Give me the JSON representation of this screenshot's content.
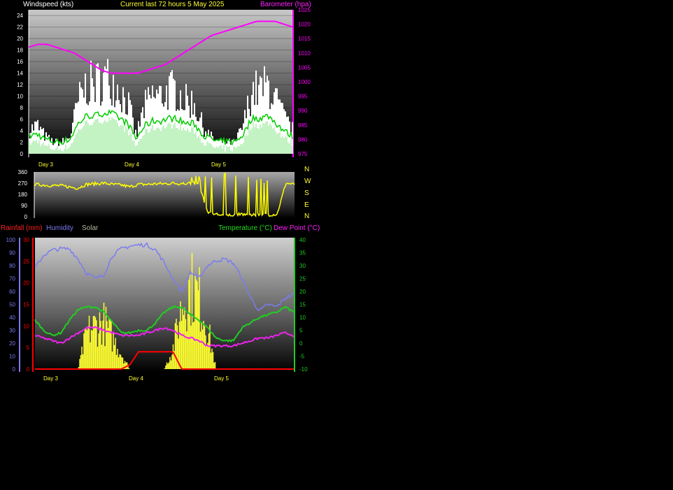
{
  "header": {
    "windspeed_label": "Windspeed (kts)",
    "current_label": "Current last 72 hours 5 May 2025",
    "barometer_label": "Barometer (hpa)"
  },
  "rain_header": {
    "rainfall_label": "Rainfall (mm)",
    "humidity_label": "Humidity",
    "solar_label": "Solar",
    "temperature_label": "Temperature (°C)",
    "dewpoint_label": "Dew Point (°C)"
  },
  "colors": {
    "wind_gust": "#ffffff",
    "wind_avg": "#00cc00",
    "wind_fill": "#b8f0b8",
    "barometer": "#ff00ff",
    "direction": "#ffff00",
    "humidity": "#7b7bf0",
    "temperature": "#22cc22",
    "dewpoint": "#ee22ee",
    "rainfall": "#ff0000",
    "solar": "#ffff33"
  },
  "chart_data": [
    {
      "id": "wind",
      "type": "area",
      "x_ticks": [
        "Day 3",
        "Day 4",
        "Day 5"
      ],
      "y_left_ticks": [
        "0",
        "2",
        "4",
        "6",
        "8",
        "10",
        "12",
        "14",
        "16",
        "18",
        "20",
        "22",
        "24"
      ],
      "y_right_ticks": [
        "975",
        "980",
        "985",
        "990",
        "995",
        "1000",
        "1005",
        "1010",
        "1015",
        "1020",
        "1025"
      ],
      "ylim_left": [
        0,
        25
      ],
      "ylim_right": [
        975,
        1025
      ],
      "series": [
        {
          "name": "Windspeed (kts)",
          "values": [
            4,
            5,
            3,
            2,
            2,
            3,
            9,
            12,
            12,
            13,
            13,
            11,
            9,
            3,
            8,
            10,
            10,
            11,
            11,
            9,
            9,
            5,
            3,
            2,
            2,
            2,
            5,
            11,
            11,
            12,
            9,
            6,
            4
          ]
        },
        {
          "name": "Barometer (hpa)",
          "values": [
            1012,
            1013,
            1013,
            1012,
            1011,
            1010,
            1008,
            1006,
            1004,
            1003,
            1003,
            1003,
            1003,
            1004,
            1005,
            1006,
            1008,
            1010,
            1012,
            1014,
            1016,
            1017,
            1018,
            1019,
            1020,
            1021,
            1021,
            1021,
            1020,
            1019
          ]
        }
      ]
    },
    {
      "id": "direction",
      "type": "line",
      "y_left_ticks": [
        "0",
        "90",
        "180",
        "270",
        "360"
      ],
      "y_right_ticks": [
        "N",
        "W",
        "S",
        "E",
        "N"
      ],
      "ylim": [
        0,
        360
      ],
      "series": [
        {
          "name": "Wind direction",
          "values": [
            260,
            255,
            250,
            250,
            240,
            230,
            260,
            265,
            270,
            260,
            255,
            240,
            260,
            260,
            265,
            265,
            270,
            265,
            270,
            265,
            30,
            20,
            10,
            15,
            20,
            10,
            20,
            15,
            20,
            270,
            260
          ]
        }
      ]
    },
    {
      "id": "weather",
      "type": "line",
      "x_ticks": [
        "Day 3",
        "Day 4",
        "Day 5"
      ],
      "humidity_ticks": [
        "0",
        "10",
        "20",
        "30",
        "40",
        "50",
        "60",
        "70",
        "80",
        "90",
        "100"
      ],
      "rain_ticks": [
        "0",
        "5",
        "10",
        "15",
        "20",
        "25",
        "30"
      ],
      "temp_ticks": [
        "-10",
        "-5",
        "0",
        "5",
        "10",
        "15",
        "20",
        "25",
        "30",
        "35",
        "40"
      ],
      "series": [
        {
          "name": "Humidity",
          "values": [
            78,
            88,
            92,
            93,
            93,
            85,
            74,
            70,
            73,
            88,
            93,
            95,
            96,
            96,
            92,
            82,
            70,
            60,
            75,
            70,
            80,
            84,
            85,
            82,
            70,
            55,
            45,
            50,
            48,
            55,
            58
          ]
        },
        {
          "name": "Temperature (°C)",
          "values": [
            9,
            5,
            3,
            4,
            9,
            13,
            14,
            14,
            12,
            8,
            4,
            4,
            5,
            5,
            8,
            12,
            14,
            14,
            11,
            9,
            6,
            2,
            1,
            1,
            6,
            8,
            10,
            11,
            12,
            14,
            12
          ]
        },
        {
          "name": "Dew Point (°C)",
          "values": [
            3,
            2,
            1,
            0,
            2,
            4,
            6,
            6,
            5,
            4,
            3,
            3,
            3,
            4,
            5,
            6,
            5,
            3,
            2,
            1,
            -1,
            -1,
            -1,
            -1,
            0,
            1,
            2,
            2,
            3,
            4,
            3
          ]
        },
        {
          "name": "Rainfall (mm)",
          "values": [
            0,
            0,
            0,
            0,
            0,
            0,
            0,
            0,
            0,
            0,
            0,
            1,
            4,
            4,
            4,
            4,
            4,
            0,
            0,
            0,
            0,
            0,
            0,
            0,
            0,
            0,
            0,
            0,
            0,
            0,
            0
          ]
        },
        {
          "name": "Solar",
          "values": [
            0,
            0,
            0,
            0,
            0,
            0,
            35,
            42,
            45,
            30,
            15,
            0,
            0,
            0,
            0,
            0,
            20,
            60,
            80,
            70,
            40,
            0,
            0,
            0,
            0,
            0,
            0,
            0,
            0,
            0,
            0
          ]
        }
      ]
    }
  ]
}
